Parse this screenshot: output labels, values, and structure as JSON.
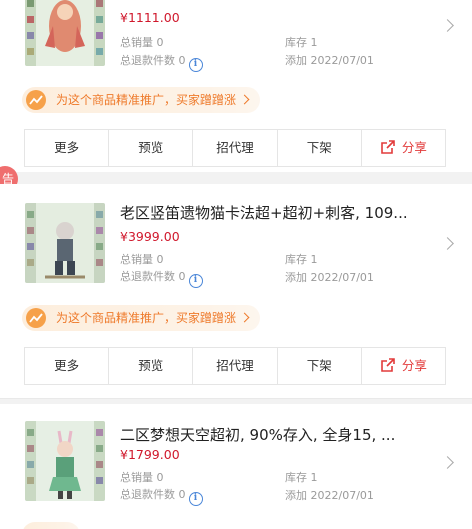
{
  "items": [
    {
      "title": "",
      "price": "¥1111.00",
      "total_sales": "总销量 0",
      "total_refunds": "总退款件数 0",
      "stock": "库存 1",
      "added": "添加 2022/07/01"
    },
    {
      "title": "老区竖笛遗物猫卡法超+超初+刺客, 109...",
      "price": "¥3999.00",
      "total_sales": "总销量 0",
      "total_refunds": "总退款件数 0",
      "stock": "库存 1",
      "added": "添加 2022/07/01"
    },
    {
      "title": "二区梦想天空超初, 90%存入, 全身15, ...",
      "price": "¥1799.00",
      "total_sales": "总销量 0",
      "total_refunds": "总退款件数 0",
      "stock": "库存 1",
      "added": "添加 2022/07/01"
    }
  ],
  "promo_text": "为这个商品精准推广，买家蹭蹭涨",
  "actions": {
    "more": "更多",
    "preview": "预览",
    "recruit_agent": "招代理",
    "delist": "下架",
    "share": "分享"
  },
  "side_badge": "告",
  "colors": {
    "price": "#d0182c",
    "promo_text": "#ee7a2b",
    "share": "#e23b3b",
    "info": "#4a86d8"
  },
  "icons": [
    "info-icon",
    "chevron-right-icon",
    "trend-icon",
    "share-icon"
  ]
}
